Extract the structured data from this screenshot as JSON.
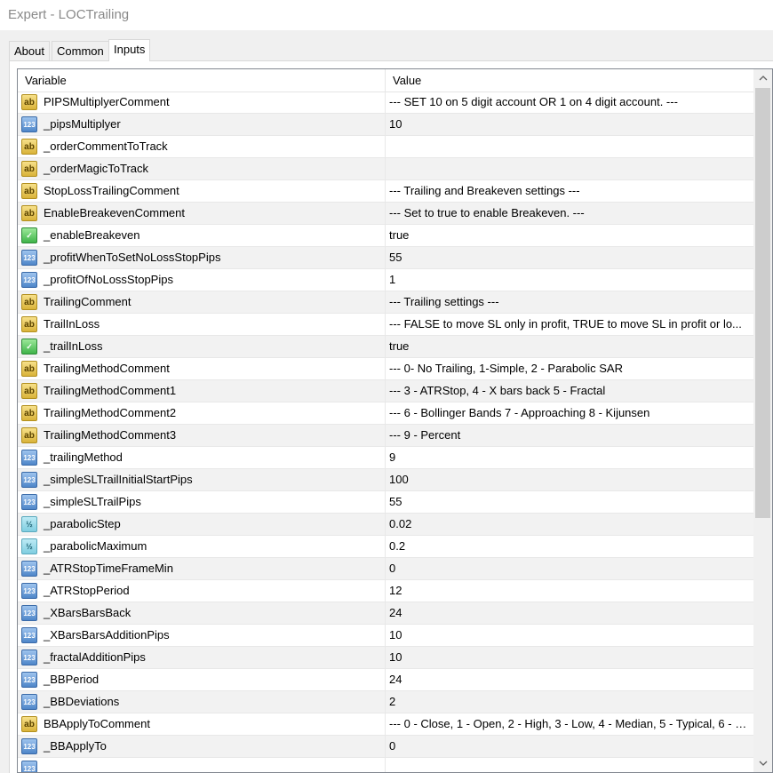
{
  "window": {
    "title": "Expert - LOCTrailing"
  },
  "tabs": [
    {
      "label": "About"
    },
    {
      "label": "Common"
    },
    {
      "label": "Inputs"
    }
  ],
  "table": {
    "headers": {
      "variable": "Variable",
      "value": "Value"
    },
    "rows": [
      {
        "type": "str",
        "icon": "ab",
        "name": "PIPSMultiplyerComment",
        "value": "--- SET 10 on 5 digit account OR 1 on 4 digit account. ---"
      },
      {
        "type": "int",
        "icon": "123",
        "name": "_pipsMultiplyer",
        "value": "10"
      },
      {
        "type": "str",
        "icon": "ab",
        "name": "_orderCommentToTrack",
        "value": ""
      },
      {
        "type": "str",
        "icon": "ab",
        "name": "_orderMagicToTrack",
        "value": ""
      },
      {
        "type": "str",
        "icon": "ab",
        "name": "StopLossTrailingComment",
        "value": "--- Trailing and Breakeven settings ---"
      },
      {
        "type": "str",
        "icon": "ab",
        "name": "EnableBreakevenComment",
        "value": "--- Set to true to enable Breakeven. ---"
      },
      {
        "type": "bool",
        "icon": "✓",
        "name": "_enableBreakeven",
        "value": "true"
      },
      {
        "type": "int",
        "icon": "123",
        "name": "_profitWhenToSetNoLossStopPips",
        "value": "55"
      },
      {
        "type": "int",
        "icon": "123",
        "name": "_profitOfNoLossStopPips",
        "value": "1"
      },
      {
        "type": "str",
        "icon": "ab",
        "name": "TrailingComment",
        "value": "--- Trailing settings ---"
      },
      {
        "type": "str",
        "icon": "ab",
        "name": "TrailInLoss",
        "value": "--- FALSE to move SL only in profit, TRUE  to move SL in profit or lo..."
      },
      {
        "type": "bool",
        "icon": "✓",
        "name": "_trailInLoss",
        "value": "true"
      },
      {
        "type": "str",
        "icon": "ab",
        "name": "TrailingMethodComment",
        "value": "--- 0- No Trailing, 1-Simple, 2 - Parabolic SAR"
      },
      {
        "type": "str",
        "icon": "ab",
        "name": "TrailingMethodComment1",
        "value": "---  3 - ATRStop, 4 - X bars back 5 - Fractal"
      },
      {
        "type": "str",
        "icon": "ab",
        "name": "TrailingMethodComment2",
        "value": "---  6 - Bollinger Bands 7 - Approaching 8 - Kijunsen"
      },
      {
        "type": "str",
        "icon": "ab",
        "name": "TrailingMethodComment3",
        "value": "---  9 - Percent"
      },
      {
        "type": "int",
        "icon": "123",
        "name": "_trailingMethod",
        "value": "9"
      },
      {
        "type": "int",
        "icon": "123",
        "name": "_simpleSLTrailInitialStartPips",
        "value": "100"
      },
      {
        "type": "int",
        "icon": "123",
        "name": "_simpleSLTrailPips",
        "value": "55"
      },
      {
        "type": "dbl",
        "icon": "½",
        "name": "_parabolicStep",
        "value": "0.02"
      },
      {
        "type": "dbl",
        "icon": "½",
        "name": "_parabolicMaximum",
        "value": "0.2"
      },
      {
        "type": "int",
        "icon": "123",
        "name": "_ATRStopTimeFrameMin",
        "value": "0"
      },
      {
        "type": "int",
        "icon": "123",
        "name": "_ATRStopPeriod",
        "value": "12"
      },
      {
        "type": "int",
        "icon": "123",
        "name": "_XBarsBarsBack",
        "value": "24"
      },
      {
        "type": "int",
        "icon": "123",
        "name": "_XBarsBarsAdditionPips",
        "value": "10"
      },
      {
        "type": "int",
        "icon": "123",
        "name": "_fractalAdditionPips",
        "value": "10"
      },
      {
        "type": "int",
        "icon": "123",
        "name": "_BBPeriod",
        "value": "24"
      },
      {
        "type": "int",
        "icon": "123",
        "name": "_BBDeviations",
        "value": "2"
      },
      {
        "type": "str",
        "icon": "ab",
        "name": "BBApplyToComment",
        "value": "--- 0 - Close, 1 - Open, 2 - High, 3 - Low, 4 - Median, 5 - Typical, 6 - W..."
      },
      {
        "type": "int",
        "icon": "123",
        "name": "_BBApplyTo",
        "value": "0"
      },
      {
        "type": "int",
        "icon": "123",
        "name": "",
        "value": ""
      }
    ]
  },
  "scrollbar": {
    "up_icon": "chevron-up-icon",
    "down_icon": "chevron-down-icon"
  }
}
